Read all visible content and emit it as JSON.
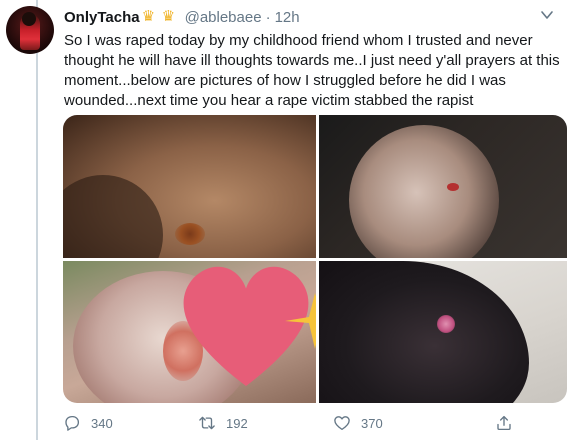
{
  "tweet": {
    "display_name": "OnlyTacha",
    "badges": [
      "crown-icon",
      "crown-icon"
    ],
    "handle": "@ablebaee",
    "separator": "·",
    "time": "12h",
    "text": "So I was raped today by my childhood friend whom I trusted and never thought he will have ill thoughts towards me..I just need y'all prayers at this moment...below are pictures of how I struggled before he did I was wounded...next time you hear a rape victim stabbed the rapist"
  },
  "actions": {
    "reply_count": "340",
    "retweet_count": "192",
    "like_count": "370"
  },
  "colors": {
    "text": "#14171a",
    "secondary": "#657786",
    "badge": "#f0b429",
    "thread_line": "#ccd6dd"
  }
}
